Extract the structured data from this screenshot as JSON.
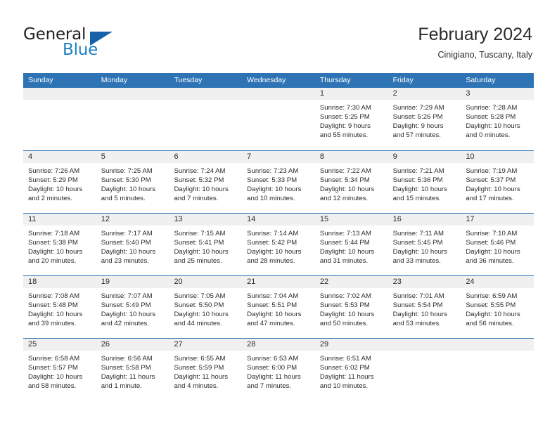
{
  "logo": {
    "word_top": "General",
    "word_bottom": "Blue",
    "triangle_icon": "triangle-icon",
    "colors": {
      "dark": "#231f20",
      "blue": "#1c7fc4",
      "triangle": "#1761a8"
    }
  },
  "header": {
    "title": "February 2024",
    "subtitle": "Cinigiano, Tuscany, Italy"
  },
  "colors": {
    "header_bar": "#2e74b5",
    "day_band": "#f0f0f0",
    "text": "#2b2b2b",
    "cell_background": "#ffffff"
  },
  "calendar": {
    "weekdays": [
      "Sunday",
      "Monday",
      "Tuesday",
      "Wednesday",
      "Thursday",
      "Friday",
      "Saturday"
    ],
    "weeks": [
      [
        {
          "day": "",
          "empty": true,
          "lines": []
        },
        {
          "day": "",
          "empty": true,
          "lines": []
        },
        {
          "day": "",
          "empty": true,
          "lines": []
        },
        {
          "day": "",
          "empty": true,
          "lines": []
        },
        {
          "day": "1",
          "empty": false,
          "lines": [
            "Sunrise: 7:30 AM",
            "Sunset: 5:25 PM",
            "Daylight: 9 hours",
            "and 55 minutes."
          ]
        },
        {
          "day": "2",
          "empty": false,
          "lines": [
            "Sunrise: 7:29 AM",
            "Sunset: 5:26 PM",
            "Daylight: 9 hours",
            "and 57 minutes."
          ]
        },
        {
          "day": "3",
          "empty": false,
          "lines": [
            "Sunrise: 7:28 AM",
            "Sunset: 5:28 PM",
            "Daylight: 10 hours",
            "and 0 minutes."
          ]
        }
      ],
      [
        {
          "day": "4",
          "empty": false,
          "lines": [
            "Sunrise: 7:26 AM",
            "Sunset: 5:29 PM",
            "Daylight: 10 hours",
            "and 2 minutes."
          ]
        },
        {
          "day": "5",
          "empty": false,
          "lines": [
            "Sunrise: 7:25 AM",
            "Sunset: 5:30 PM",
            "Daylight: 10 hours",
            "and 5 minutes."
          ]
        },
        {
          "day": "6",
          "empty": false,
          "lines": [
            "Sunrise: 7:24 AM",
            "Sunset: 5:32 PM",
            "Daylight: 10 hours",
            "and 7 minutes."
          ]
        },
        {
          "day": "7",
          "empty": false,
          "lines": [
            "Sunrise: 7:23 AM",
            "Sunset: 5:33 PM",
            "Daylight: 10 hours",
            "and 10 minutes."
          ]
        },
        {
          "day": "8",
          "empty": false,
          "lines": [
            "Sunrise: 7:22 AM",
            "Sunset: 5:34 PM",
            "Daylight: 10 hours",
            "and 12 minutes."
          ]
        },
        {
          "day": "9",
          "empty": false,
          "lines": [
            "Sunrise: 7:21 AM",
            "Sunset: 5:36 PM",
            "Daylight: 10 hours",
            "and 15 minutes."
          ]
        },
        {
          "day": "10",
          "empty": false,
          "lines": [
            "Sunrise: 7:19 AM",
            "Sunset: 5:37 PM",
            "Daylight: 10 hours",
            "and 17 minutes."
          ]
        }
      ],
      [
        {
          "day": "11",
          "empty": false,
          "lines": [
            "Sunrise: 7:18 AM",
            "Sunset: 5:38 PM",
            "Daylight: 10 hours",
            "and 20 minutes."
          ]
        },
        {
          "day": "12",
          "empty": false,
          "lines": [
            "Sunrise: 7:17 AM",
            "Sunset: 5:40 PM",
            "Daylight: 10 hours",
            "and 23 minutes."
          ]
        },
        {
          "day": "13",
          "empty": false,
          "lines": [
            "Sunrise: 7:15 AM",
            "Sunset: 5:41 PM",
            "Daylight: 10 hours",
            "and 25 minutes."
          ]
        },
        {
          "day": "14",
          "empty": false,
          "lines": [
            "Sunrise: 7:14 AM",
            "Sunset: 5:42 PM",
            "Daylight: 10 hours",
            "and 28 minutes."
          ]
        },
        {
          "day": "15",
          "empty": false,
          "lines": [
            "Sunrise: 7:13 AM",
            "Sunset: 5:44 PM",
            "Daylight: 10 hours",
            "and 31 minutes."
          ]
        },
        {
          "day": "16",
          "empty": false,
          "lines": [
            "Sunrise: 7:11 AM",
            "Sunset: 5:45 PM",
            "Daylight: 10 hours",
            "and 33 minutes."
          ]
        },
        {
          "day": "17",
          "empty": false,
          "lines": [
            "Sunrise: 7:10 AM",
            "Sunset: 5:46 PM",
            "Daylight: 10 hours",
            "and 36 minutes."
          ]
        }
      ],
      [
        {
          "day": "18",
          "empty": false,
          "lines": [
            "Sunrise: 7:08 AM",
            "Sunset: 5:48 PM",
            "Daylight: 10 hours",
            "and 39 minutes."
          ]
        },
        {
          "day": "19",
          "empty": false,
          "lines": [
            "Sunrise: 7:07 AM",
            "Sunset: 5:49 PM",
            "Daylight: 10 hours",
            "and 42 minutes."
          ]
        },
        {
          "day": "20",
          "empty": false,
          "lines": [
            "Sunrise: 7:05 AM",
            "Sunset: 5:50 PM",
            "Daylight: 10 hours",
            "and 44 minutes."
          ]
        },
        {
          "day": "21",
          "empty": false,
          "lines": [
            "Sunrise: 7:04 AM",
            "Sunset: 5:51 PM",
            "Daylight: 10 hours",
            "and 47 minutes."
          ]
        },
        {
          "day": "22",
          "empty": false,
          "lines": [
            "Sunrise: 7:02 AM",
            "Sunset: 5:53 PM",
            "Daylight: 10 hours",
            "and 50 minutes."
          ]
        },
        {
          "day": "23",
          "empty": false,
          "lines": [
            "Sunrise: 7:01 AM",
            "Sunset: 5:54 PM",
            "Daylight: 10 hours",
            "and 53 minutes."
          ]
        },
        {
          "day": "24",
          "empty": false,
          "lines": [
            "Sunrise: 6:59 AM",
            "Sunset: 5:55 PM",
            "Daylight: 10 hours",
            "and 56 minutes."
          ]
        }
      ],
      [
        {
          "day": "25",
          "empty": false,
          "lines": [
            "Sunrise: 6:58 AM",
            "Sunset: 5:57 PM",
            "Daylight: 10 hours",
            "and 58 minutes."
          ]
        },
        {
          "day": "26",
          "empty": false,
          "lines": [
            "Sunrise: 6:56 AM",
            "Sunset: 5:58 PM",
            "Daylight: 11 hours",
            "and 1 minute."
          ]
        },
        {
          "day": "27",
          "empty": false,
          "lines": [
            "Sunrise: 6:55 AM",
            "Sunset: 5:59 PM",
            "Daylight: 11 hours",
            "and 4 minutes."
          ]
        },
        {
          "day": "28",
          "empty": false,
          "lines": [
            "Sunrise: 6:53 AM",
            "Sunset: 6:00 PM",
            "Daylight: 11 hours",
            "and 7 minutes."
          ]
        },
        {
          "day": "29",
          "empty": false,
          "lines": [
            "Sunrise: 6:51 AM",
            "Sunset: 6:02 PM",
            "Daylight: 11 hours",
            "and 10 minutes."
          ]
        },
        {
          "day": "",
          "empty": true,
          "lines": []
        },
        {
          "day": "",
          "empty": true,
          "lines": []
        }
      ]
    ]
  }
}
